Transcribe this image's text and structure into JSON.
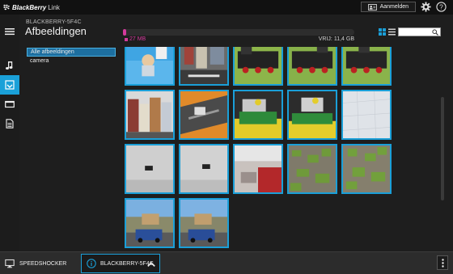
{
  "app": {
    "brand": "BlackBerry",
    "product": "Link"
  },
  "titlebar": {
    "login_label": "Aanmelden"
  },
  "header": {
    "device_name": "BLACKBERRY-5F4C",
    "title": "Afbeeldingen"
  },
  "storage": {
    "used": "27 MB",
    "free": "VRIJ: 11,4 GB",
    "used_fraction": 0.004,
    "used_color": "#d43a9c"
  },
  "search": {
    "value": "",
    "placeholder": ""
  },
  "folders": [
    {
      "label": "Alle afbeeldingen",
      "selected": true
    },
    {
      "label": "camera",
      "selected": false
    }
  ],
  "nav": [
    {
      "icon": "menu-icon"
    },
    {
      "icon": "music-note-icon"
    },
    {
      "icon": "pictures-icon",
      "active": true
    },
    {
      "icon": "video-icon"
    },
    {
      "icon": "documents-icon"
    }
  ],
  "thumbnails": [
    "lego-figure-blue",
    "lego-city-street",
    "lego-train-engine",
    "lego-train-engine",
    "lego-train-engine",
    "lego-buildings",
    "lego-tracks-orange",
    "lego-train-green",
    "lego-train-green",
    "ceiling-white",
    "wall-outlet",
    "wall-outlet",
    "table-corner",
    "grass-pavement",
    "grass-pavement",
    "parking-lot-car",
    "parking-lot-car"
  ],
  "bottom": {
    "pc_label": "SPEEDSHOCKER",
    "device_label": "BLACKBERRY-5F4C"
  },
  "colors": {
    "accent": "#1a9fd8",
    "background": "#1e1e1e"
  }
}
